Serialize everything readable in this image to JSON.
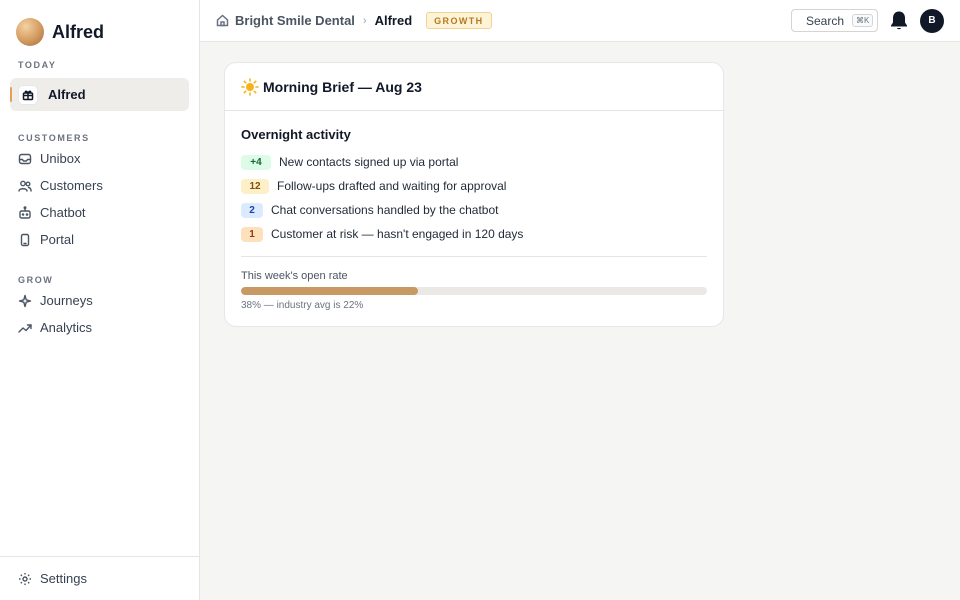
{
  "sidebar": {
    "brand": "Alfred",
    "sections": {
      "today": "TODAY",
      "customers": "CUSTOMERS",
      "grow": "GROW"
    },
    "active_item": "Alfred",
    "customers_items": [
      "Unibox",
      "Customers",
      "Chatbot",
      "Portal"
    ],
    "grow_items": [
      "Journeys",
      "Analytics"
    ],
    "footer": "Settings"
  },
  "topbar": {
    "org": "Bright Smile Dental",
    "separator": "›",
    "current": "Alfred",
    "plan_badge": "GROWTH",
    "search_label": "Search",
    "search_shortcut": "⌘K",
    "avatar_initial": "B"
  },
  "brief": {
    "title": "Morning Brief — Aug 23",
    "section_title": "Overnight activity",
    "items": [
      {
        "count": "+4",
        "text": "New contacts signed up via portal",
        "tone": "green"
      },
      {
        "count": "12",
        "text": "Follow-ups drafted and waiting for approval",
        "tone": "amber"
      },
      {
        "count": "2",
        "text": "Chat conversations handled by the chatbot",
        "tone": "blue"
      },
      {
        "count": "1",
        "text": "Customer at risk — hasn't engaged in 120 days",
        "tone": "orange"
      }
    ],
    "open_rate_label": "This week's open rate",
    "open_rate_percent": 38,
    "open_rate_caption": "38% — industry avg is 22%"
  },
  "colors": {
    "accent": "#e0a15b",
    "progress": "#c99964",
    "badge_text": "#b7791f"
  }
}
